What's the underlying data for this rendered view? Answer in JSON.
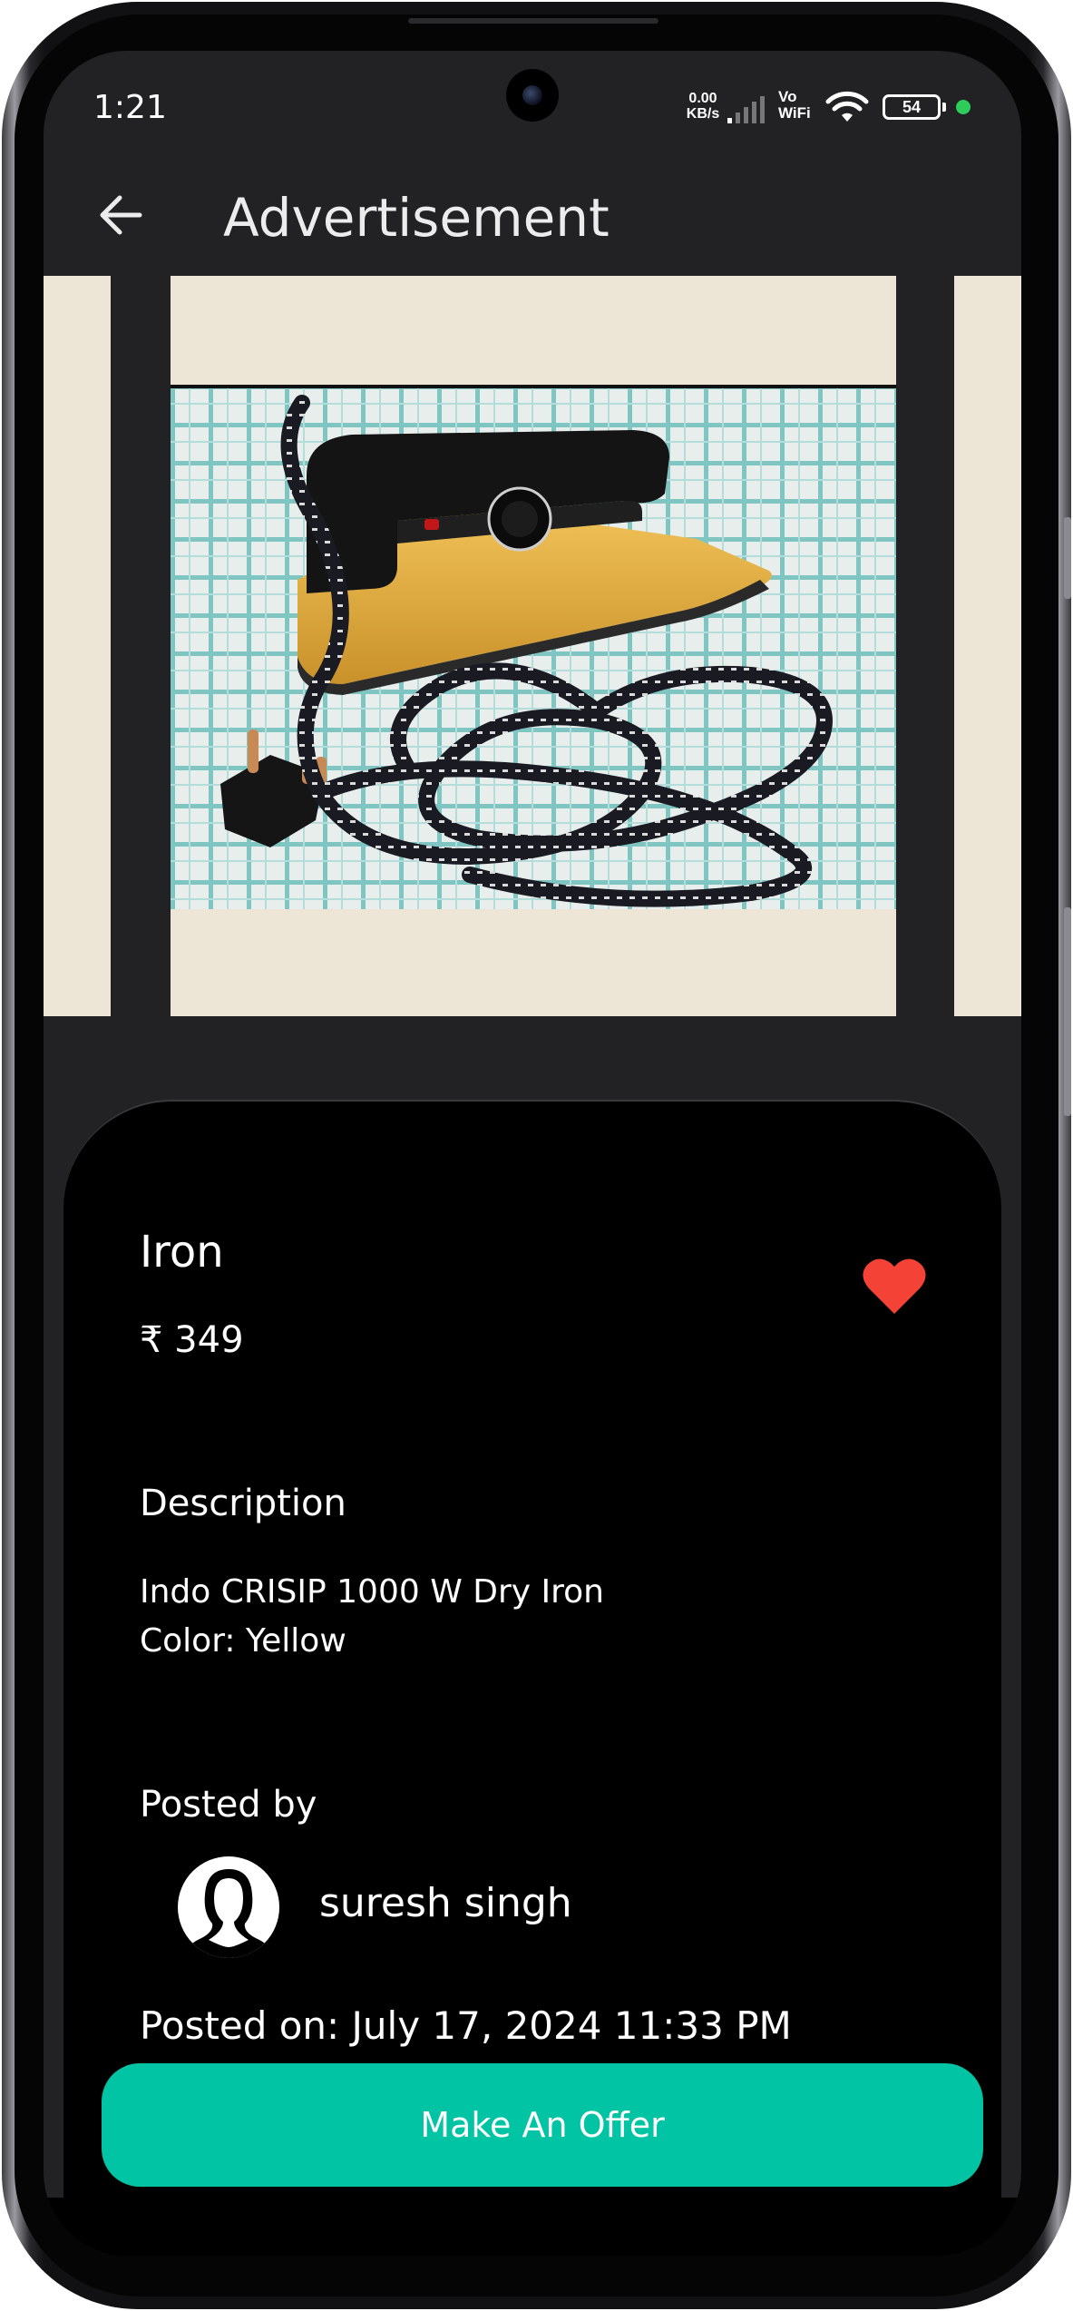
{
  "status_bar": {
    "time": "1:21",
    "net_speed_value": "0.00",
    "net_speed_unit": "KB/s",
    "vo_label": "Vo",
    "wifi_label": "WiFi",
    "battery_level": "54",
    "icons": [
      "signal-icon",
      "wifi-icon",
      "battery-icon"
    ]
  },
  "app_bar": {
    "title": "Advertisement",
    "back_icon": "arrow-left-icon"
  },
  "carousel": {
    "image_subject": "Yellow dry iron with braided black and white cord",
    "photo_alt": "Iron product photo"
  },
  "listing": {
    "title": "Iron",
    "currency_symbol": "₹",
    "price": "349",
    "favorite": true,
    "favorite_color": "#f44336",
    "description_heading": "Description",
    "description_lines": [
      "Indo CRISIP 1000 W Dry Iron",
      "Color: Yellow"
    ],
    "posted_by_heading": "Posted by",
    "poster_name": "suresh singh",
    "posted_on": "Posted on: July 17, 2024 11:33 PM"
  },
  "actions": {
    "make_offer_label": "Make An Offer",
    "accent_color": "#00c4a3"
  }
}
